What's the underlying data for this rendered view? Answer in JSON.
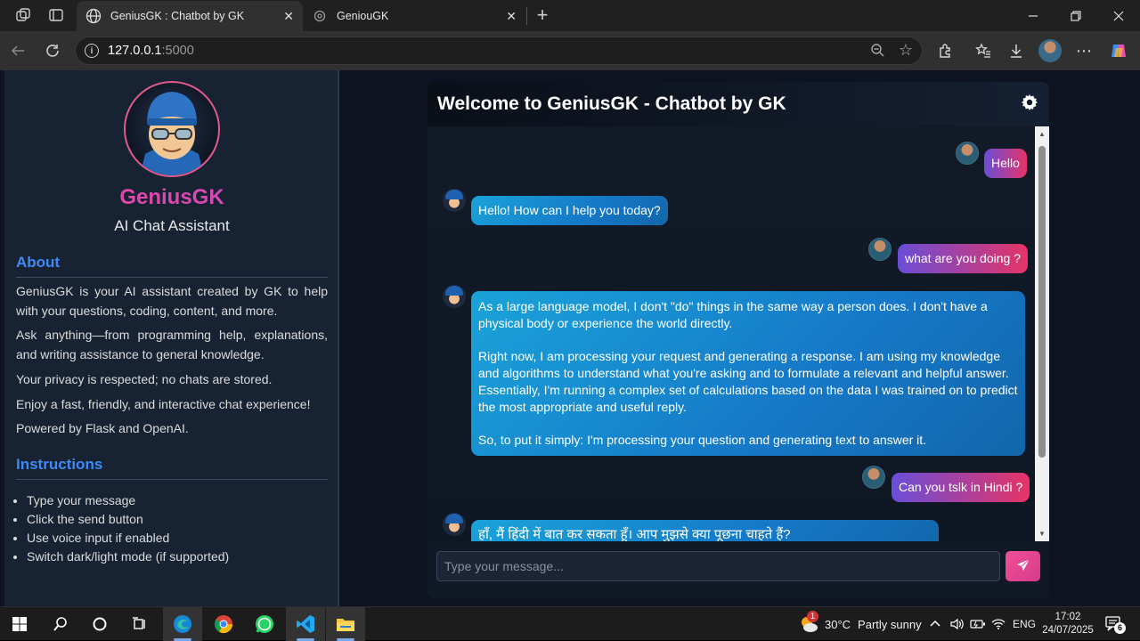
{
  "browser": {
    "tabs": [
      {
        "title": "GeniusGK : Chatbot by GK",
        "active": true
      },
      {
        "title": "GeniouGK",
        "active": false
      }
    ],
    "url_host": "127.0.0.1",
    "url_port": ":5000"
  },
  "sidebar": {
    "name": "GeniusGK",
    "subtitle": "AI Chat Assistant",
    "about_heading": "About",
    "about": [
      "GeniusGK is your AI assistant created by GK to help with your questions, coding, content, and more.",
      "Ask anything—from programming help, explanations, and writing assistance to general knowledge.",
      "Your privacy is respected; no chats are stored.",
      "Enjoy a fast, friendly, and interactive chat experience!",
      "Powered by Flask and OpenAI."
    ],
    "instructions_heading": "Instructions",
    "instructions": [
      "Type your message",
      "Click the send button",
      "Use voice input if enabled",
      "Switch dark/light mode (if supported)"
    ]
  },
  "chat": {
    "title": "Welcome to GeniusGK - Chatbot by GK",
    "messages": [
      {
        "role": "user",
        "text": "Hello"
      },
      {
        "role": "bot",
        "text": "Hello! How can I help you today?"
      },
      {
        "role": "user",
        "text": "what are you doing ?"
      },
      {
        "role": "bot",
        "p1": "As a large language model, I don't \"do\" things in the same way a person does. I don't have a physical body or experience the world directly.",
        "p2": "Right now, I am processing your request and generating a response. I am using my knowledge and algorithms to understand what you're asking and to formulate a relevant and helpful answer. Essentially, I'm running a complex set of calculations based on the data I was trained on to predict the most appropriate and useful reply.",
        "p3": "So, to put it simply: I'm processing your question and generating text to answer it."
      },
      {
        "role": "user",
        "text": "Can you tslk in Hindi ?"
      },
      {
        "role": "bot",
        "text": "हाँ, मैं हिंदी में बात कर सकता हूँ। आप मुझसे क्या पूछना चाहते हैं?"
      }
    ],
    "input_placeholder": "Type your message..."
  },
  "taskbar": {
    "temperature": "30°C",
    "weather": "Partly sunny",
    "weather_badge": "1",
    "lang": "ENG",
    "time": "17:02",
    "date": "24/07/2025",
    "notifications": "6"
  },
  "colors": {
    "accent_blue": "#3d8af7",
    "brand_pink": "#e5509a",
    "bot_bubble": "#1a8fd6",
    "user_bubble_start": "#6a4ed8",
    "user_bubble_end": "#e63366"
  }
}
